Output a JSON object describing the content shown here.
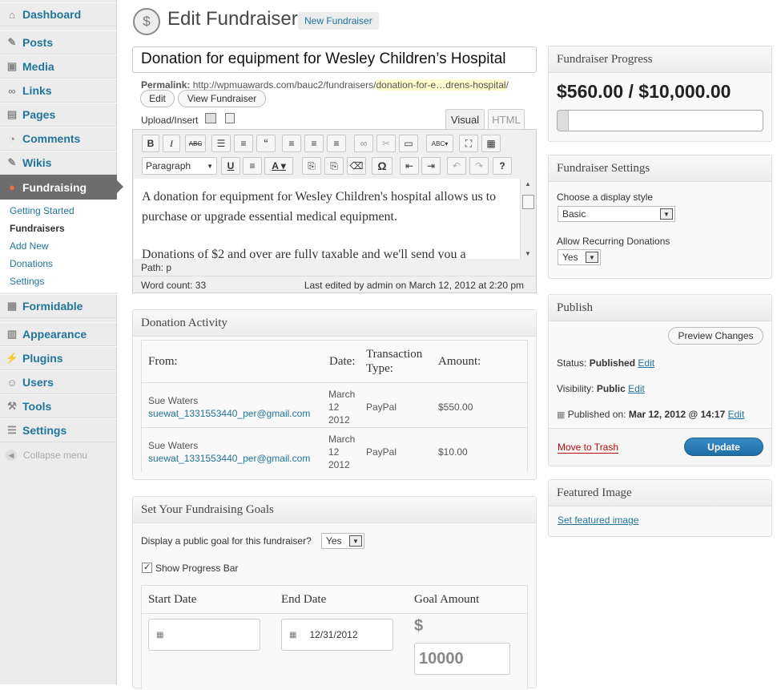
{
  "sidebar": {
    "dashboard": "Dashboard",
    "posts": "Posts",
    "media": "Media",
    "links": "Links",
    "pages": "Pages",
    "comments": "Comments",
    "wikis": "Wikis",
    "fundraising": "Fundraising",
    "submenu": {
      "getting_started": "Getting Started",
      "fundraisers": "Fundraisers",
      "add_new": "Add New",
      "donations": "Donations",
      "settings": "Settings"
    },
    "formidable": "Formidable",
    "appearance": "Appearance",
    "plugins": "Plugins",
    "users": "Users",
    "tools": "Tools",
    "settings": "Settings",
    "collapse": "Collapse menu"
  },
  "header": {
    "title": "Edit Fundraiser",
    "new_button": "New Fundraiser"
  },
  "post": {
    "title": "Donation for equipment for Wesley Children’s Hospital",
    "permalink_label": "Permalink:",
    "permalink_base": "http://wpmuawards.com/bauc2/fundraisers/",
    "permalink_slug": "donation-for-e…drens-hospital",
    "permalink_end": "/",
    "edit_button": "Edit",
    "view_button": "View Fundraiser",
    "upload_label": "Upload/Insert"
  },
  "editor": {
    "tab_visual": "Visual",
    "tab_html": "HTML",
    "format_select": "Paragraph",
    "paragraph1": "A donation for equipment for Wesley Children's hospital allows us to purchase or upgrade essential medical equipment.",
    "paragraph2": "Donations of $2 and over are fully taxable and we'll send you a",
    "path_label": "Path:",
    "path_value": "p",
    "word_count": "Word count: 33",
    "last_edited": "Last edited by admin on March 12, 2012 at 2:20 pm"
  },
  "donation_activity": {
    "title": "Donation Activity",
    "columns": [
      "From:",
      "Date:",
      "Transaction Type:",
      "Amount:"
    ],
    "rows": [
      {
        "name": "Sue Waters",
        "email": "suewat_1331553440_per@gmail.com",
        "date_month": "March",
        "date_day": "12",
        "date_year": "2012",
        "type": "PayPal",
        "amount": "$550.00"
      },
      {
        "name": "Sue Waters",
        "email": "suewat_1331553440_per@gmail.com",
        "date_month": "March",
        "date_day": "12",
        "date_year": "2012",
        "type": "PayPal",
        "amount": "$10.00"
      }
    ]
  },
  "goals": {
    "title": "Set Your Fundraising Goals",
    "display_goal_label": "Display a public goal for this fundraiser?",
    "display_goal_value": "Yes",
    "progress_bar_label": "Show Progress Bar",
    "columns": [
      "Start Date",
      "End Date",
      "Goal Amount"
    ],
    "start_date": "",
    "end_date": "12/31/2012",
    "currency": "$",
    "goal_amount": "10000"
  },
  "progress": {
    "title": "Fundraiser Progress",
    "amount": "$560.00 / $10,000.00",
    "fraction": 0.056
  },
  "fundraiser_settings": {
    "title": "Fundraiser Settings",
    "display_style_label": "Choose a display style",
    "display_style_value": "Basic",
    "recurring_label": "Allow Recurring Donations",
    "recurring_value": "Yes"
  },
  "publish": {
    "title": "Publish",
    "preview_button": "Preview Changes",
    "status_label": "Status:",
    "status_value": "Published",
    "visibility_label": "Visibility:",
    "visibility_value": "Public",
    "published_on_label": "Published on:",
    "published_on_value": "Mar 12, 2012 @ 14:17",
    "edit_link": "Edit",
    "trash_link": "Move to Trash",
    "update_button": "Update"
  },
  "featured_image": {
    "title": "Featured Image",
    "link": "Set featured image"
  },
  "colors": {
    "link": "#21759b",
    "active_menu": "#6d6d6d",
    "update_button": "#2a7ab0",
    "trash": "#bc0b0b"
  }
}
